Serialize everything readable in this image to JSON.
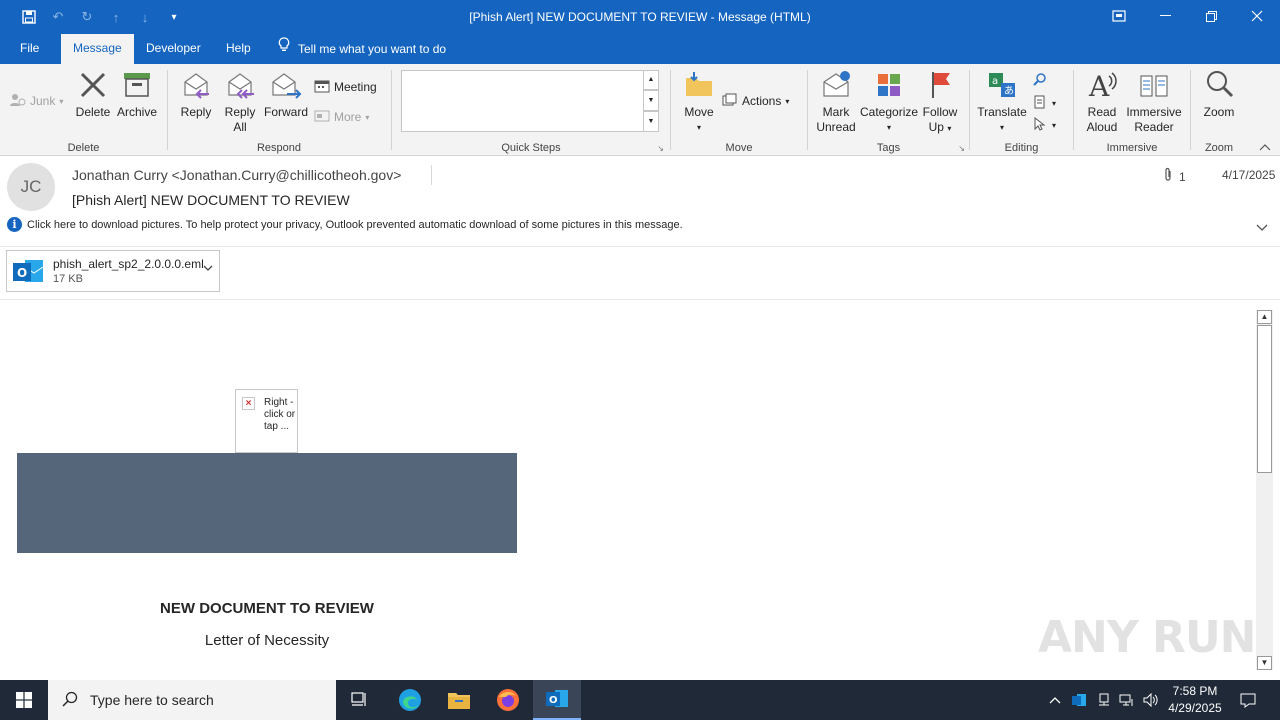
{
  "window": {
    "title": "[Phish Alert] NEW DOCUMENT TO REVIEW  -  Message (HTML)"
  },
  "menu": {
    "tabs": [
      "File",
      "Message",
      "Developer",
      "Help"
    ],
    "active_tab": "Message",
    "tell_me": "Tell me what you want to do"
  },
  "ribbon": {
    "junk": "Junk",
    "delete": "Delete",
    "archive": "Archive",
    "group_delete": "Delete",
    "reply": "Reply",
    "reply_all_1": "Reply",
    "reply_all_2": "All",
    "forward": "Forward",
    "meeting": "Meeting",
    "more": "More",
    "group_respond": "Respond",
    "group_quick_steps": "Quick Steps",
    "move": "Move",
    "actions": "Actions",
    "group_move": "Move",
    "mark_unread_1": "Mark",
    "mark_unread_2": "Unread",
    "categorize": "Categorize",
    "follow_up_1": "Follow",
    "follow_up_2": "Up",
    "group_tags": "Tags",
    "translate": "Translate",
    "group_editing": "Editing",
    "read_aloud_1": "Read",
    "read_aloud_2": "Aloud",
    "immersive_reader_1": "Immersive",
    "immersive_reader_2": "Reader",
    "group_immersive": "Immersive",
    "zoom": "Zoom",
    "group_zoom": "Zoom"
  },
  "message": {
    "avatar_initials": "JC",
    "sender": "Jonathan Curry <Jonathan.Curry@chillicotheoh.gov>",
    "subject": "[Phish Alert] NEW DOCUMENT TO REVIEW",
    "attachment_count": "1",
    "date": "4/17/2025",
    "info_bar": "Click here to download pictures. To help protect your privacy, Outlook prevented automatic download of some pictures in this message."
  },
  "attachment": {
    "name": "phish_alert_sp2_2.0.0.0.eml",
    "size": "17 KB"
  },
  "body": {
    "broken_image_text": "Right -click or tap ...",
    "doc_title": "NEW DOCUMENT TO REVIEW",
    "doc_subtitle": "Letter of Necessity"
  },
  "watermark": "ANY RUN",
  "taskbar": {
    "search_placeholder": "Type here to search",
    "time": "7:58 PM",
    "date": "4/29/2025"
  }
}
